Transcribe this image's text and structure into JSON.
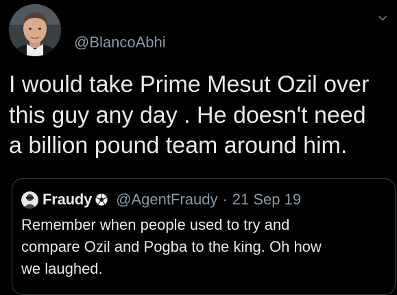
{
  "tweet": {
    "handle": "@BlancoAbhi",
    "text": "I would take Prime Mesut Ozil over\nthis guy any day . He doesn't need\na billion pound team around him.",
    "menu_icon": "chevron-down-icon"
  },
  "quoted_tweet": {
    "name": "Fraudy",
    "badge_icon": "soccer-ball-icon",
    "handle": "@AgentFraudy",
    "separator": "·",
    "date": "21 Sep 19",
    "text": "Remember when people used to try and\ncompare Ozil and Pogba to the king. Oh how\nwe laughed."
  },
  "colors": {
    "background": "#000000",
    "primary_text": "#e7e9ea",
    "secondary_text": "#8b98a5",
    "border": "#3b4148"
  }
}
